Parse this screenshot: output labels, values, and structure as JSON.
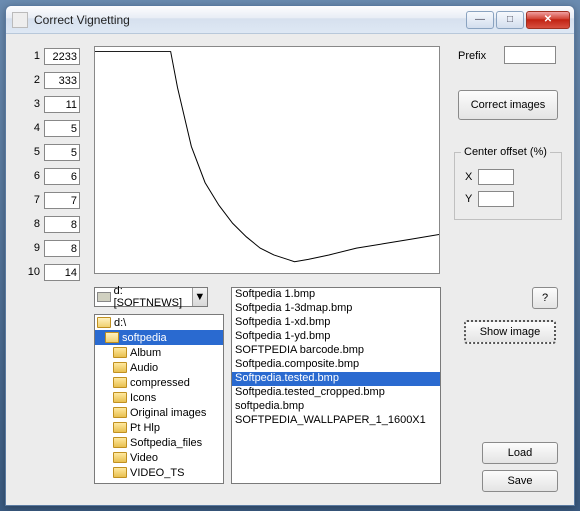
{
  "window": {
    "title": "Correct Vignetting",
    "min": "—",
    "max": "□",
    "close": "✕"
  },
  "params": {
    "labels": [
      "1",
      "2",
      "3",
      "4",
      "5",
      "6",
      "7",
      "8",
      "9",
      "10"
    ],
    "values": [
      "2233",
      "333",
      "11",
      "5",
      "5",
      "6",
      "7",
      "8",
      "8",
      "14"
    ]
  },
  "prefix": {
    "label": "Prefix",
    "value": ""
  },
  "buttons": {
    "correct": "Correct images",
    "question": "?",
    "show": "Show image",
    "load": "Load",
    "save": "Save"
  },
  "center_offset": {
    "title": "Center offset (%)",
    "x_label": "X",
    "y_label": "Y",
    "x": "",
    "y": ""
  },
  "drive": {
    "text": "d: [SOFTNEWS]",
    "arrow": "▼"
  },
  "folders": [
    {
      "name": "d:\\",
      "depth": 0,
      "open": true,
      "selected": false
    },
    {
      "name": "softpedia",
      "depth": 1,
      "open": true,
      "selected": true
    },
    {
      "name": "Album",
      "depth": 2,
      "open": false,
      "selected": false
    },
    {
      "name": "Audio",
      "depth": 2,
      "open": false,
      "selected": false
    },
    {
      "name": "compressed",
      "depth": 2,
      "open": false,
      "selected": false
    },
    {
      "name": "Icons",
      "depth": 2,
      "open": false,
      "selected": false
    },
    {
      "name": "Original images",
      "depth": 2,
      "open": false,
      "selected": false
    },
    {
      "name": "Pt Hlp",
      "depth": 2,
      "open": false,
      "selected": false
    },
    {
      "name": "Softpedia_files",
      "depth": 2,
      "open": false,
      "selected": false
    },
    {
      "name": "Video",
      "depth": 2,
      "open": false,
      "selected": false
    },
    {
      "name": "VIDEO_TS",
      "depth": 2,
      "open": false,
      "selected": false
    }
  ],
  "files": [
    {
      "name": "Softpedia 1.bmp",
      "selected": false
    },
    {
      "name": "Softpedia 1-3dmap.bmp",
      "selected": false
    },
    {
      "name": "Softpedia 1-xd.bmp",
      "selected": false
    },
    {
      "name": "Softpedia 1-yd.bmp",
      "selected": false
    },
    {
      "name": "SOFTPEDIA barcode.bmp",
      "selected": false
    },
    {
      "name": "Softpedia.composite.bmp",
      "selected": false
    },
    {
      "name": "Softpedia.tested.bmp",
      "selected": true
    },
    {
      "name": "Softpedia.tested_cropped.bmp",
      "selected": false
    },
    {
      "name": "softpedia.bmp",
      "selected": false
    },
    {
      "name": "SOFTPEDIA_WALLPAPER_1_1600X1",
      "selected": false
    }
  ],
  "chart_data": {
    "type": "line",
    "title": "",
    "xlabel": "",
    "ylabel": "",
    "xlim": [
      0,
      100
    ],
    "ylim": [
      0,
      100
    ],
    "x": [
      0,
      22,
      24,
      28,
      32,
      36,
      40,
      44,
      48,
      52,
      56,
      58,
      62,
      68,
      76,
      84,
      92,
      100
    ],
    "y": [
      98,
      98,
      82,
      56,
      40,
      30,
      22,
      16,
      11,
      8,
      6,
      5,
      6,
      8,
      11,
      13,
      15,
      17
    ]
  }
}
